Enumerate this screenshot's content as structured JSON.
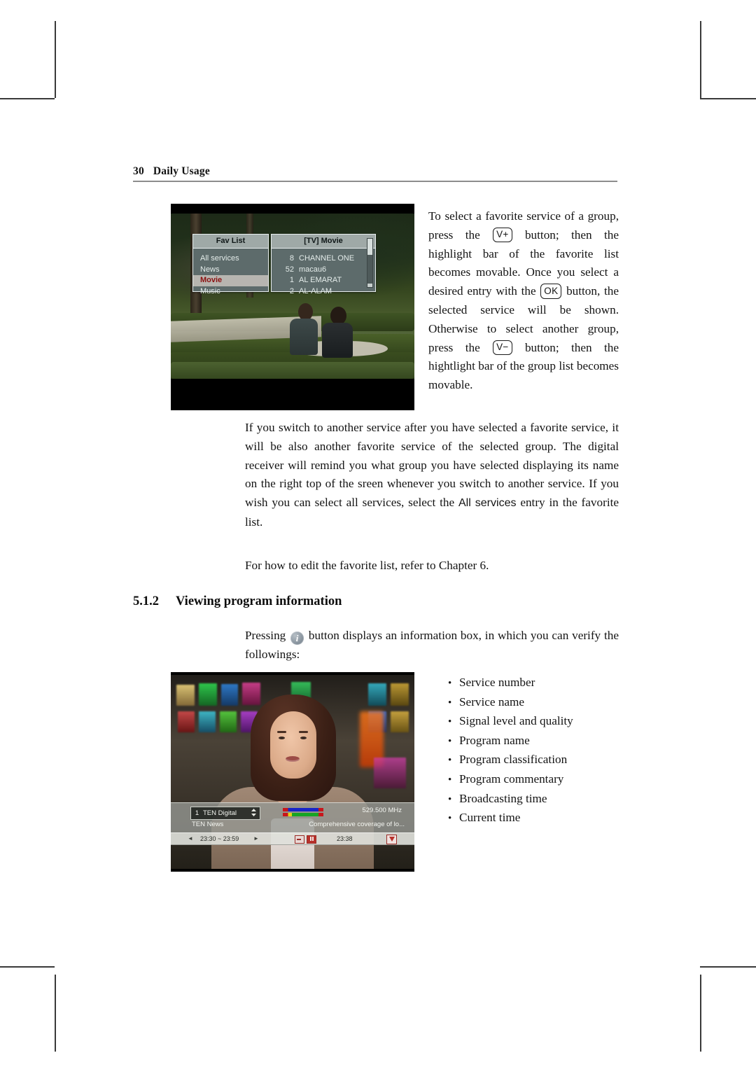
{
  "running_head": {
    "page_number": "30",
    "chapter": "Daily Usage"
  },
  "paragraphs": {
    "side_text_parts": [
      "To select a favorite service of a group, press the ",
      " button; then the highlight bar of the favorite list becomes movable. Once you select a desired entry with the ",
      " button, the selected service will be shown.  Otherwise to select another group, press the ",
      " button; then the hightlight bar of the group list becomes movable."
    ],
    "keys": {
      "vol_up": "V+",
      "ok": "OK",
      "vol_down": "V−"
    },
    "para2_parts": [
      "If you switch to another service after you have selected a favorite service, it will be also another favorite service of the selected group. The digital receiver will remind you what group you have selected displaying its name on the right top of the sreen whenever you switch to another service.  If you wish you can select all services, select the ",
      "All services",
      " entry in the favorite list."
    ],
    "para3": "For how to edit the favorite list, refer to Chapter 6."
  },
  "section": {
    "number": "5.1.2",
    "title": "Viewing program information"
  },
  "info_intro": {
    "before_icon": "Pressing ",
    "icon_letter": "i",
    "after_icon": " button displays an information box, in which you can verify the followings:"
  },
  "bullet_list": {
    "marker": "•",
    "items": [
      "Service number",
      "Service name",
      "Signal level and quality",
      "Program name",
      "Program classification",
      "Program commentary",
      "Broadcasting time",
      "Current time"
    ]
  },
  "screenshot_fav_list": {
    "caption_alt": "Favorite list OSD over TV picture",
    "group_panel": {
      "title": "Fav List",
      "items": [
        {
          "label": "All services",
          "selected": false
        },
        {
          "label": "News",
          "selected": false
        },
        {
          "label": "Movie",
          "selected": true
        },
        {
          "label": "Music",
          "selected": false
        }
      ]
    },
    "service_panel": {
      "title": "[TV] Movie",
      "items": [
        {
          "number": "8",
          "name": "CHANNEL ONE"
        },
        {
          "number": "52",
          "name": "macau6"
        },
        {
          "number": "1",
          "name": "AL EMARAT"
        },
        {
          "number": "2",
          "name": "AL-ALAM"
        }
      ]
    }
  },
  "screenshot_info_box": {
    "caption_alt": "Information box over news broadcast",
    "channel_number": "1",
    "channel_name": "TEN Digital",
    "frequency": "529.500 MHz",
    "program_name": "TEN News",
    "program_description": "Comprehensive coverage of lo...",
    "broadcast_time": "23:30 ~ 23:59",
    "current_time": "23:38",
    "left_arrow": "◄",
    "right_arrow": "►",
    "icons": [
      "subtitle-icon",
      "teletext-icon",
      "classification-icon"
    ]
  },
  "colors": {
    "rule": "#8d8d8d",
    "osd_panel": "#5d6b6b",
    "osd_title_bar": "#9fa9a7",
    "osd_highlight": "#b7b5b0",
    "osd_highlight_text": "#8b1111",
    "info_badge": "#8e99a3"
  }
}
